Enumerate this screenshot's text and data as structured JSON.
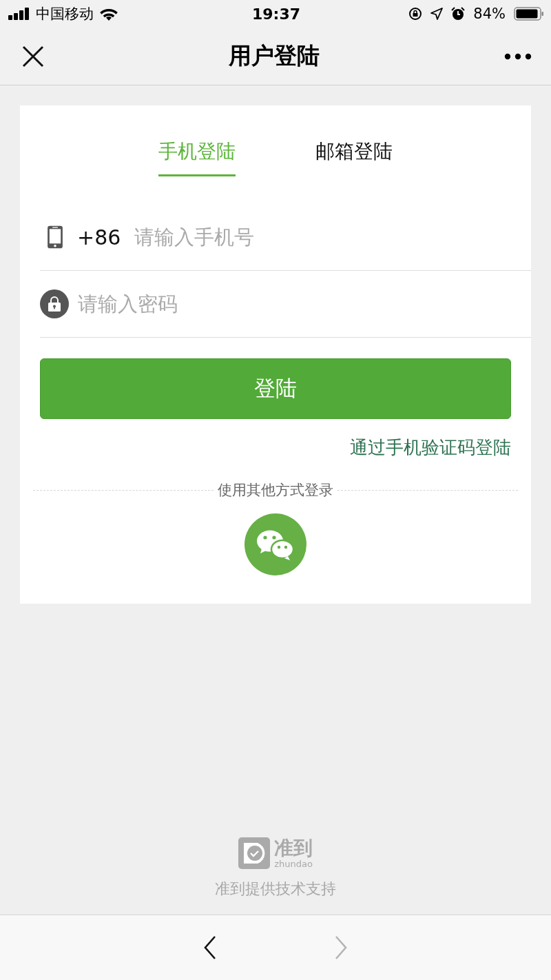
{
  "status_bar": {
    "carrier": "中国移动",
    "time": "19:37",
    "battery": "84%"
  },
  "nav_bar": {
    "title": "用户登陆"
  },
  "tabs": [
    {
      "label": "手机登陆",
      "selected": true
    },
    {
      "label": "邮箱登陆",
      "selected": false
    }
  ],
  "phone_field": {
    "prefix": "+86",
    "placeholder": "请输入手机号"
  },
  "password_field": {
    "placeholder": "请输入密码"
  },
  "login_button": "登陆",
  "sms_login_link": "通过手机验证码登陆",
  "other_login_label": "使用其他方式登录",
  "footer": {
    "logo_text": "准到",
    "logo_subtext": "zhundao",
    "credit": "准到提供技术支持"
  },
  "toolbar": [
    {
      "kind": "back",
      "disabled": false
    },
    {
      "kind": "forward",
      "disabled": true
    }
  ]
}
